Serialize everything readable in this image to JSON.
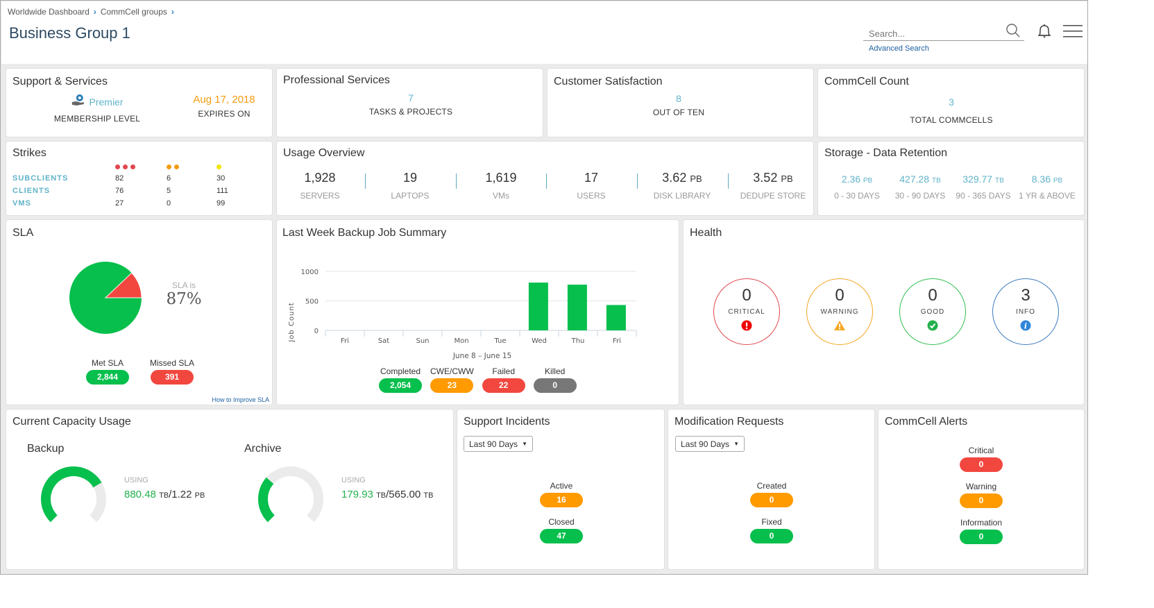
{
  "header": {
    "breadcrumbs": [
      "Worldwide Dashboard",
      "CommCell groups"
    ],
    "title": "Business Group 1",
    "search_placeholder": "Search...",
    "advanced_search": "Advanced Search",
    "icons": [
      "search-icon",
      "bell-icon",
      "hamburger-menu-icon"
    ]
  },
  "support_services": {
    "title": "Support & Services",
    "membership_value": "Premier",
    "membership_label": "MEMBERSHIP LEVEL",
    "expires_value": "Aug 17, 2018",
    "expires_label": "EXPIRES ON"
  },
  "professional_services": {
    "title": "Professional Services",
    "value": "7",
    "label": "TASKS & PROJECTS"
  },
  "customer_satisfaction": {
    "title": "Customer Satisfaction",
    "value": "8",
    "label": "OUT OF TEN"
  },
  "commcell_count": {
    "title": "CommCell Count",
    "value": "3",
    "label": "TOTAL COMMCELLS"
  },
  "strikes": {
    "title": "Strikes",
    "columns": [
      {
        "dots": 3,
        "color": "#e0474c"
      },
      {
        "dots": 2,
        "color": "#f39c12"
      },
      {
        "dots": 1,
        "color": "#f1e40f"
      }
    ],
    "rows": [
      {
        "label": "SUBCLIENTS",
        "values": [
          "82",
          "6",
          "30"
        ]
      },
      {
        "label": "CLIENTS",
        "values": [
          "76",
          "5",
          "111"
        ]
      },
      {
        "label": "VMS",
        "values": [
          "27",
          "0",
          "99"
        ]
      }
    ]
  },
  "usage_overview": {
    "title": "Usage Overview",
    "items": [
      {
        "value": "1,928",
        "unit": "",
        "label": "SERVERS"
      },
      {
        "value": "19",
        "unit": "",
        "label": "LAPTOPS"
      },
      {
        "value": "1,619",
        "unit": "",
        "label": "VMs"
      },
      {
        "value": "17",
        "unit": "",
        "label": "USERS"
      },
      {
        "value": "3.62",
        "unit": "PB",
        "label": "DISK LIBRARY"
      },
      {
        "value": "3.52",
        "unit": "PB",
        "label": "DEDUPE STORE"
      }
    ]
  },
  "storage_retention": {
    "title": "Storage - Data Retention",
    "items": [
      {
        "value": "2.36",
        "unit": "PB",
        "label": "0 - 30 DAYS"
      },
      {
        "value": "427.28",
        "unit": "TB",
        "label": "30 - 90 DAYS"
      },
      {
        "value": "329.77",
        "unit": "TB",
        "label": "90 - 365 DAYS"
      },
      {
        "value": "8.36",
        "unit": "PB",
        "label": "1 YR & ABOVE"
      }
    ]
  },
  "sla": {
    "title": "SLA",
    "sla_is_label": "SLA is",
    "percent": "87%",
    "met_label": "Met SLA",
    "met_value": "2,844",
    "missed_label": "Missed SLA",
    "missed_value": "391",
    "improve_link": "How to Improve SLA",
    "colors": {
      "met": "#06bf4c",
      "missed": "#f2473f"
    }
  },
  "backup_summary": {
    "title": "Last Week Backup Job Summary",
    "legend": [
      {
        "label": "Completed",
        "value": "2,054",
        "color": "green"
      },
      {
        "label": "CWE/CWW",
        "value": "23",
        "color": "orange"
      },
      {
        "label": "Failed",
        "value": "22",
        "color": "red"
      },
      {
        "label": "Killed",
        "value": "0",
        "color": "grey"
      }
    ]
  },
  "chart_data": {
    "type": "bar",
    "title": "Last Week Backup Job Summary",
    "categories": [
      "Fri",
      "Sat",
      "Sun",
      "Mon",
      "Tue",
      "Wed",
      "Thu",
      "Fri"
    ],
    "values": [
      0,
      0,
      0,
      0,
      0,
      810,
      775,
      430
    ],
    "xlabel": "June 8 – June 15",
    "ylabel": "Job Count",
    "ylim": [
      0,
      1000
    ],
    "yticks": [
      0,
      500,
      1000
    ],
    "grid": true,
    "color": "#06bf4c"
  },
  "health": {
    "title": "Health",
    "items": [
      {
        "value": "0",
        "label": "CRITICAL",
        "color": "#e0474c",
        "icon": "critical-icon"
      },
      {
        "value": "0",
        "label": "WARNING",
        "color": "#f5a623",
        "icon": "warning-icon"
      },
      {
        "value": "0",
        "label": "GOOD",
        "color": "#2ebf4f",
        "icon": "check-icon"
      },
      {
        "value": "3",
        "label": "INFO",
        "color": "#3b7bc0",
        "icon": "info-icon"
      }
    ]
  },
  "capacity": {
    "title": "Current Capacity Usage",
    "items": [
      {
        "name": "Backup",
        "using_label": "USING",
        "used": "880.48",
        "used_unit": "TB",
        "total": "1.22",
        "total_unit": "PB",
        "fraction": 0.72
      },
      {
        "name": "Archive",
        "using_label": "USING",
        "used": "179.93",
        "used_unit": "TB",
        "total": "565.00",
        "total_unit": "TB",
        "fraction": 0.32
      }
    ]
  },
  "support_incidents": {
    "title": "Support Incidents",
    "range": "Last 90 Days",
    "items": [
      {
        "label": "Active",
        "value": "16",
        "color": "orange"
      },
      {
        "label": "Closed",
        "value": "47",
        "color": "green"
      }
    ]
  },
  "modification_requests": {
    "title": "Modification Requests",
    "range": "Last 90 Days",
    "items": [
      {
        "label": "Created",
        "value": "0",
        "color": "orange"
      },
      {
        "label": "Fixed",
        "value": "0",
        "color": "green"
      }
    ]
  },
  "commcell_alerts": {
    "title": "CommCell Alerts",
    "items": [
      {
        "label": "Critical",
        "value": "0",
        "color": "red"
      },
      {
        "label": "Warning",
        "value": "0",
        "color": "orange"
      },
      {
        "label": "Information",
        "value": "0",
        "color": "green"
      }
    ]
  }
}
